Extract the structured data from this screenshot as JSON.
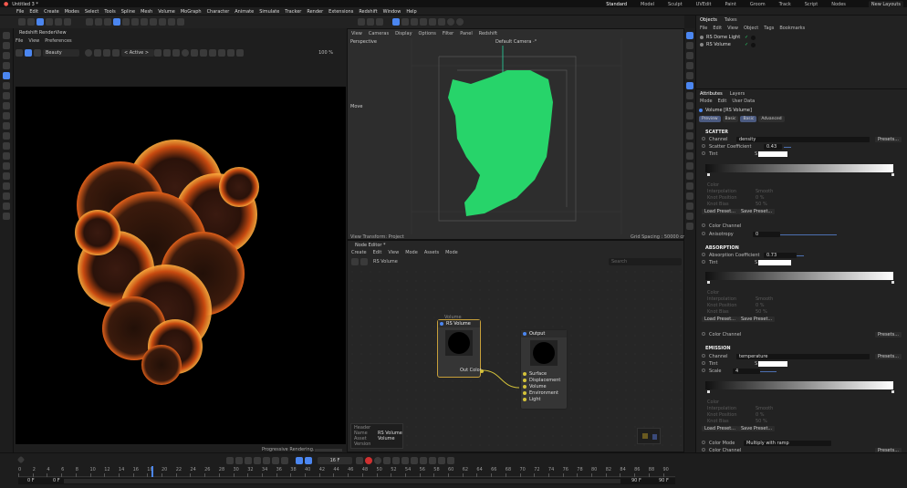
{
  "menubar": {
    "tab": "Untitled 3 *",
    "items": [
      "File",
      "Edit",
      "Create",
      "Modes",
      "Select",
      "Tools",
      "Spline",
      "Mesh",
      "Volume",
      "MoGraph",
      "Character",
      "Animate",
      "Simulate",
      "Tracker",
      "Render",
      "Extensions",
      "Redshift",
      "Window",
      "Help"
    ],
    "layouts": [
      "Standard",
      "Model",
      "Sculpt",
      "UVEdit",
      "Paint",
      "Groom",
      "Track",
      "Script",
      "Nodes"
    ],
    "new_layouts": "New Layouts"
  },
  "rs_view": {
    "title": "Redshift RenderView",
    "menu": [
      "File",
      "View",
      "Preferences"
    ],
    "select_value": "Beauty",
    "active_value": "< Active >",
    "zoom": "100 %",
    "status": "Progressive Rendering..."
  },
  "viewport": {
    "label": "Perspective",
    "camera": "Default Camera ·°",
    "move": "Move",
    "view_transform": "View Transform: Project",
    "grid": "Grid Spacing : 50000 cm",
    "menu": [
      "View",
      "Cameras",
      "Display",
      "Options",
      "Filter",
      "Panel",
      "Redshift"
    ]
  },
  "node_editor": {
    "title": "Node Editor *",
    "menu": [
      "Create",
      "Edit",
      "View",
      "Mode",
      "Assets",
      "Mode"
    ],
    "breadcrumb": "RS Volume",
    "search_placeholder": "Search",
    "group_label": "Volume",
    "node1": "RS Volume",
    "node1_out": "Out Color",
    "node2": "Output",
    "node2_ports": [
      "Surface",
      "Displacement",
      "Volume",
      "Environment",
      "Light"
    ],
    "info": {
      "header": "Header",
      "keys": [
        "Name",
        "Asset",
        "Version"
      ],
      "vals": [
        "RS Volume",
        "Volume",
        ""
      ]
    }
  },
  "objects": {
    "tabs": [
      "Objects",
      "Takes"
    ],
    "menu": [
      "File",
      "Edit",
      "View",
      "Object",
      "Tags",
      "Bookmarks"
    ],
    "items": [
      "RS Dome Light",
      "RS Volume"
    ]
  },
  "attributes": {
    "tabs": [
      "Attributes",
      "Layers"
    ],
    "menu": [
      "Mode",
      "Edit",
      "User Data"
    ],
    "object": "Volume [RS Volume]",
    "subtabs": [
      "Preview",
      "Basic",
      "Basic",
      "Advanced"
    ],
    "scatter": {
      "header": "SCATTER",
      "channel_label": "Channel",
      "channel_value": "density",
      "presets": "Presets...",
      "coef_label": "Scatter Coefficient",
      "coef_value": "0.43",
      "tint_label": "Tint",
      "tint_prefix": "S",
      "dim": [
        "Color",
        "Interpolation",
        "Knot Position",
        "Knot Bias"
      ],
      "dim_vals": [
        "Smooth",
        "0 %",
        "50 %"
      ],
      "load": "Load Preset...",
      "save": "Save Preset...",
      "cc_label": "Color Channel",
      "aniso_label": "Anisotropy",
      "aniso_value": "0"
    },
    "absorption": {
      "header": "ABSORPTION",
      "coef_label": "Absorption Coefficient",
      "coef_value": "0.73",
      "tint_label": "Tint",
      "tint_prefix": "S",
      "dim": [
        "Color",
        "Interpolation",
        "Knot Position",
        "Knot Bias"
      ],
      "dim_vals": [
        "Smooth",
        "0 %",
        "50 %"
      ],
      "load": "Load Preset...",
      "save": "Save Preset...",
      "cc_label": "Color Channel",
      "presets": "Presets..."
    },
    "emission": {
      "header": "EMISSION",
      "channel_label": "Channel",
      "channel_value": "temperature",
      "presets": "Presets...",
      "tint_label": "Tint",
      "tint_prefix": "S",
      "scale_label": "Scale",
      "scale_value": "4",
      "dim": [
        "Color",
        "Interpolation",
        "Knot Position",
        "Knot Bias"
      ],
      "dim_vals": [
        "Smooth",
        "0 %",
        "50 %"
      ],
      "load": "Load Preset...",
      "save": "Save Preset...",
      "cm_label": "Color Mode",
      "cm_value": "Multiply with ramp",
      "cc_label": "Color Channel",
      "cc_presets": "Presets...",
      "pm_label": "Preview Mode",
      "pm_value": "Blackbody",
      "temp_label": "Temperature",
      "temp_value": "3606",
      "off_label": "Offset",
      "off_value": "1"
    }
  },
  "timeline": {
    "ticks": [
      "0",
      "2",
      "4",
      "6",
      "8",
      "10",
      "12",
      "14",
      "16",
      "18",
      "20",
      "22",
      "24",
      "26",
      "28",
      "30",
      "32",
      "34",
      "36",
      "38",
      "40",
      "42",
      "44",
      "46",
      "48",
      "50",
      "52",
      "54",
      "56",
      "58",
      "60",
      "62",
      "64",
      "66",
      "68",
      "70",
      "72",
      "74",
      "76",
      "78",
      "80",
      "82",
      "84",
      "86",
      "88",
      "90"
    ],
    "current": "16 F",
    "start": "0 F",
    "start2": "0 F",
    "end": "90 F",
    "end2": "90 F"
  },
  "colors": {
    "accent": "#4b86f0",
    "green": "#27d46a",
    "bg": "#1b1b1b"
  }
}
